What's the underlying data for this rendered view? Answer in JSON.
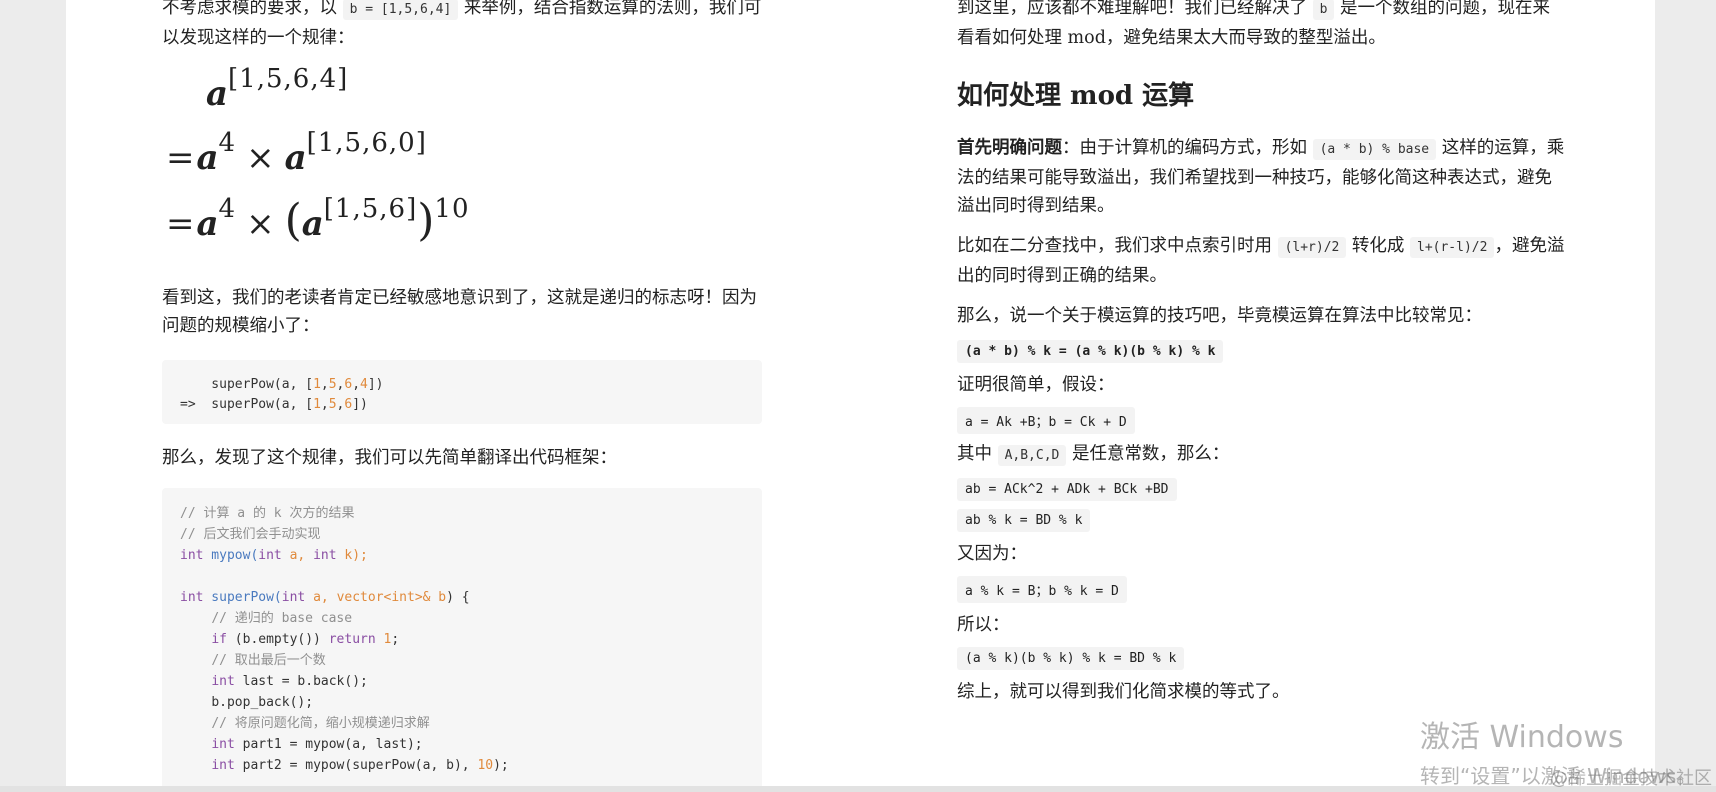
{
  "left": {
    "intro": {
      "pre": "不考虑求模的要求，以 ",
      "code": "b = [1,5,6,4]",
      "post": " 来举例，结合指数运算的法则，我们可以发现这样的一个规律："
    },
    "math": {
      "base": "a",
      "exp1": "[1,5,6,4]",
      "eq": "=",
      "exp4": "4",
      "times": "×",
      "exp2": "[1,5,6,0]",
      "exp3": "[1,5,6]",
      "pow10": "10"
    },
    "para2": "看到这，我们的老读者肯定已经敏感地意识到了，这就是递归的标志呀！因为问题的规模缩小了：",
    "code1": {
      "line1_prefix": "    superPow(a, [",
      "line2_prefix": "=>  superPow(a, [",
      "n1": "1",
      "n5": "5",
      "n6": "6",
      "n4": "4",
      "sep": ",",
      "close": "])"
    },
    "para3": "那么，发现了这个规律，我们可以先简单翻译出代码框架：",
    "code2": {
      "c1": "// 计算 a 的 k 次方的结果",
      "c2": "// 后文我们会手动实现",
      "l3_kw": "int",
      "l3_fn": " mypow(",
      "l3_kw2": "int",
      "l3_a": " a, ",
      "l3_kw3": "int",
      "l3_k": " k);",
      "l5_kw": "int",
      "l5_fn": " superPow(",
      "l5_kw2": "int",
      "l5_a": " a, ",
      "l5_vec": "vector<int>& b",
      "l5_end": ") {",
      "c3": "// 递归的 base case",
      "l7_kw": "if",
      "l7_mid": " (b.empty()) ",
      "l7_kw2": "return",
      "l7_num": "1",
      "l7_end": ";",
      "c4": "// 取出最后一个数",
      "l9_kw": "int",
      "l9_rest": " last = b.back();",
      "l10": "b.pop_back();",
      "c5": "// 将原问题化简，缩小规模递归求解",
      "l12_kw": "int",
      "l12_rest": " part1 = mypow(a, last);",
      "l13_kw": "int",
      "l13_rest": " part2 = mypow(superPow(a, b), ",
      "l13_num": "10",
      "l13_end": ");"
    }
  },
  "right": {
    "para1": {
      "pre": "到这里，应该都不难理解吧！我们已经解决了 ",
      "code": "b",
      "post": " 是一个数组的问题，现在来看看如何处理 mod，避免结果太大而导致的整型溢出。"
    },
    "heading": "如何处理 mod 运算",
    "para2": {
      "bold": "首先明确问题",
      "pre": "：由于计算机的编码方式，形如 ",
      "code": "(a * b) % base",
      "post": " 这样的运算，乘法的结果可能导致溢出，我们希望找到一种技巧，能够化简这种表达式，避免溢出同时得到结果。"
    },
    "para3": {
      "pre": "比如在二分查找中，我们求中点索引时用 ",
      "code1": "(l+r)/2",
      "mid": " 转化成 ",
      "code2": "l+(r-l)/2",
      "post": "，避免溢出的同时得到正确的结果。"
    },
    "para4": "那么，说一个关于模运算的技巧吧，毕竟模运算在算法中比较常见：",
    "formula_main": "(a * b) % k = (a % k)(b % k) % k",
    "para5": "证明很简单，假设：",
    "formula_assume": "a = Ak +B；b = Ck + D",
    "para6": {
      "pre": "其中 ",
      "code": "A,B,C,D",
      "post": " 是任意常数，那么："
    },
    "formula_ab": "ab = ACk^2 + ADk + BCk +BD",
    "formula_abk": "ab % k = BD % k",
    "para7": "又因为：",
    "formula_mod": "a % k = B；b % k = D",
    "para8": "所以：",
    "formula_final": "(a % k)(b % k) % k = BD % k",
    "para9": "综上，就可以得到我们化简求模的等式了。"
  },
  "watermarks": {
    "windows_line1": "激活 Windows",
    "windows_line2": "转到“设置”以激活 Windows。",
    "juejin": "@稀土掘金技术社区"
  }
}
